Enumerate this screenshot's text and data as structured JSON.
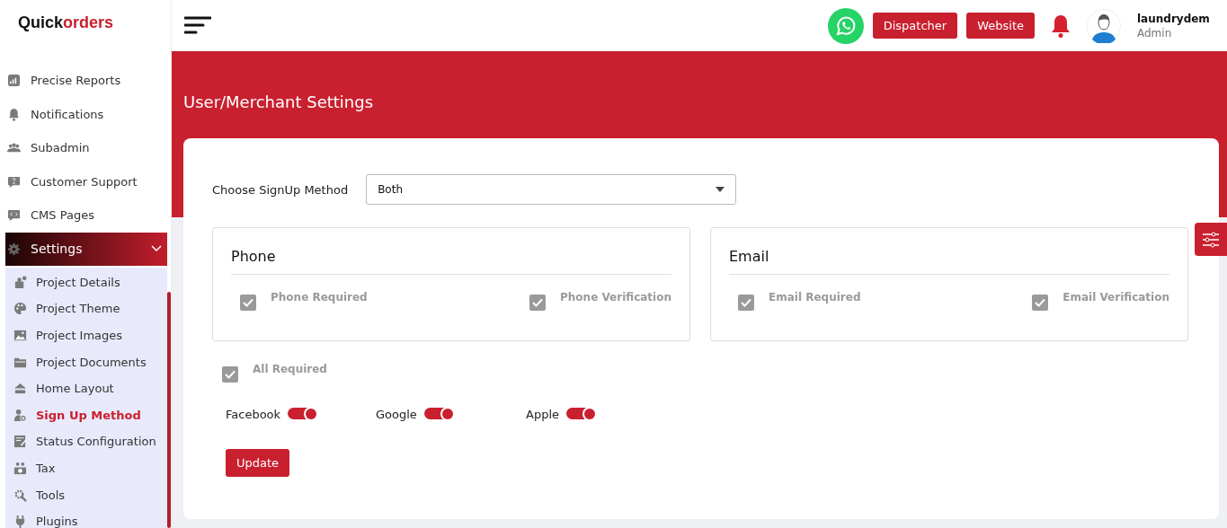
{
  "logo": {
    "first": "Quick",
    "second": "orders"
  },
  "sidebar": {
    "items": [
      {
        "label": "Precise Reports"
      },
      {
        "label": "Notifications"
      },
      {
        "label": "Subadmin"
      },
      {
        "label": "Customer Support"
      },
      {
        "label": "CMS Pages"
      },
      {
        "label": "Settings",
        "expanded": true,
        "children": [
          {
            "label": "Project Details",
            "selected": false
          },
          {
            "label": "Project Theme",
            "selected": false
          },
          {
            "label": "Project Images",
            "selected": false
          },
          {
            "label": "Project Documents",
            "selected": false
          },
          {
            "label": "Home Layout",
            "selected": false
          },
          {
            "label": "Sign Up Method",
            "selected": true
          },
          {
            "label": "Status Configuration",
            "selected": false
          },
          {
            "label": "Tax",
            "selected": false
          },
          {
            "label": "Tools",
            "selected": false
          },
          {
            "label": "Plugins",
            "selected": false
          }
        ]
      }
    ]
  },
  "topbar": {
    "buttons": [
      "Dispatcher",
      "Website"
    ],
    "user": {
      "name": "laundrydem",
      "role": "Admin"
    }
  },
  "page_title": "User/Merchant Settings",
  "signup": {
    "label": "Choose SignUp Method",
    "value": "Both"
  },
  "groups": [
    {
      "title": "Phone",
      "options": [
        {
          "label": "Phone Required",
          "checked": true
        },
        {
          "label": "Phone Verification",
          "checked": true
        }
      ]
    },
    {
      "title": "Email",
      "options": [
        {
          "label": "Email Required",
          "checked": true
        },
        {
          "label": "Email Verification",
          "checked": true
        }
      ]
    }
  ],
  "all_required": {
    "label": "All Required",
    "checked": true
  },
  "social": [
    {
      "label": "Facebook",
      "on": true
    },
    {
      "label": "Google",
      "on": true
    },
    {
      "label": "Apple",
      "on": true
    }
  ],
  "update_button": "Update"
}
